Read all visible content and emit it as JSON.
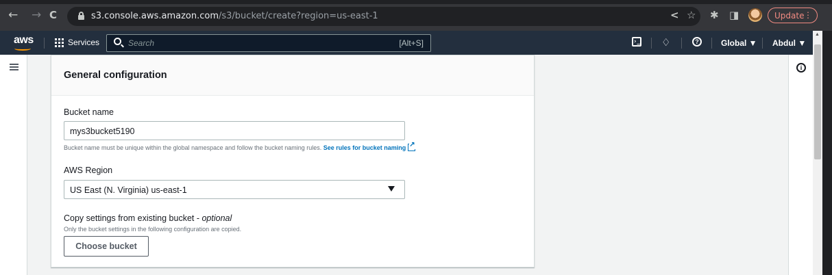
{
  "browser": {
    "back_icon": "←",
    "forward_icon": "→",
    "reload_icon": "C",
    "url_host": "s3.console.aws.amazon.com",
    "url_path": "/s3/bucket/create?region=us-east-1",
    "share_icon": "<",
    "bookmark_icon": "☆",
    "extensions_icon": "✱",
    "split_icon": "◨",
    "update_label": "Update",
    "menu_icon": "⋮"
  },
  "aws_header": {
    "logo": "aws",
    "services_label": "Services",
    "search_placeholder": "Search",
    "search_shortcut": "[Alt+S]",
    "cloudshell_glyph": "›_",
    "bell_icon": "♢",
    "help_glyph": "?",
    "region_menu": "Global ▼",
    "account_menu": "Abdul ▼"
  },
  "general_configuration": {
    "title": "General configuration",
    "bucket_name": {
      "label": "Bucket name",
      "value": "mys3bucket5190",
      "hint": "Bucket name must be unique within the global namespace and follow the bucket naming rules.",
      "rules_link": "See rules for bucket naming"
    },
    "aws_region": {
      "label": "AWS Region",
      "selected": "US East (N. Virginia) us-east-1"
    },
    "copy_settings": {
      "label": "Copy settings from existing bucket - ",
      "optional": "optional",
      "hint": "Only the bucket settings in the following configuration are copied.",
      "button": "Choose bucket"
    }
  },
  "info_glyph": "i"
}
